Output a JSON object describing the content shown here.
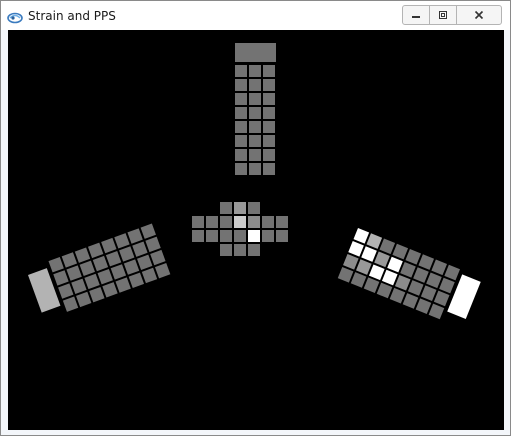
{
  "window": {
    "title": "Strain and PPS",
    "icon": "app-icon",
    "controls": [
      "minimize-icon",
      "restore-icon",
      "close-icon"
    ]
  },
  "colors": {
    "background": "#000000",
    "dim": "#6a6a6a",
    "mid": "#8c8c8c",
    "light": "#b0b0b0",
    "white": "#ffffff"
  },
  "sensors": {
    "top": {
      "bar_level": 0.45,
      "grid_rows": 8,
      "grid_cols": 3,
      "levels": [
        0.45,
        0.45,
        0.45,
        0.45,
        0.45,
        0.45,
        0.45,
        0.45,
        0.45,
        0.45,
        0.45,
        0.45,
        0.45,
        0.45,
        0.45,
        0.45,
        0.45,
        0.45,
        0.45,
        0.45,
        0.45,
        0.45,
        0.45,
        0.45
      ]
    },
    "center": {
      "rows": [
        [
          null,
          0.45,
          0.6,
          0.45,
          null
        ],
        [
          0.45,
          0.45,
          0.8,
          0.55,
          0.45
        ],
        [
          0.45,
          0.45,
          0.45,
          1.0,
          0.45
        ],
        [
          null,
          0.45,
          0.45,
          0.45,
          null
        ]
      ]
    },
    "left": {
      "bar_level": 0.7,
      "grid_rows": 4,
      "grid_cols": 8,
      "levels": [
        0.45,
        0.45,
        0.45,
        0.45,
        0.45,
        0.45,
        0.45,
        0.45,
        0.45,
        0.45,
        0.45,
        0.45,
        0.45,
        0.45,
        0.45,
        0.45,
        0.45,
        0.45,
        0.45,
        0.45,
        0.45,
        0.45,
        0.45,
        0.45,
        0.45,
        0.45,
        0.45,
        0.45,
        0.45,
        0.45,
        0.45,
        0.45
      ]
    },
    "right": {
      "bar_level": 1.0,
      "grid_rows": 4,
      "grid_cols": 8,
      "levels": [
        1.0,
        0.7,
        0.45,
        0.45,
        0.45,
        0.45,
        0.45,
        0.45,
        1.0,
        1.0,
        0.6,
        1.0,
        0.45,
        0.45,
        0.45,
        0.45,
        0.55,
        0.6,
        1.0,
        1.0,
        0.55,
        0.45,
        0.45,
        0.45,
        0.45,
        0.45,
        0.45,
        0.45,
        0.45,
        0.45,
        0.45,
        0.45
      ]
    }
  }
}
